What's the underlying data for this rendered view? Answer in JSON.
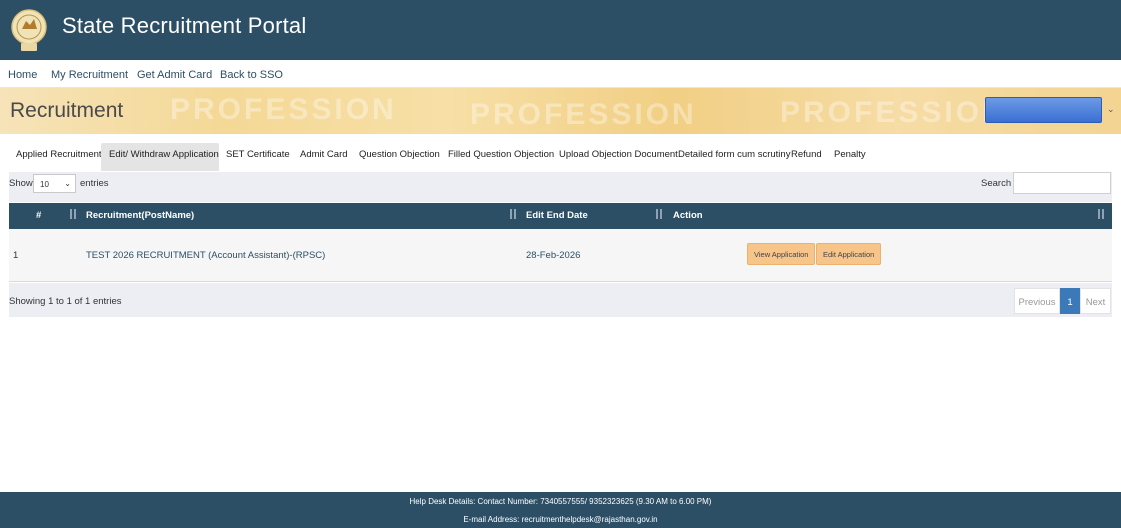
{
  "header": {
    "title": "State Recruitment Portal",
    "logo_icon": "emblem-logo-icon"
  },
  "nav": {
    "items": [
      "Home",
      "My Recruitment",
      "Get Admit Card",
      "Back to SSO"
    ]
  },
  "banner": {
    "title": "Recruitment",
    "background_words": [
      "PROFESSION",
      "PROFESSION",
      "PROFESSION"
    ]
  },
  "tabs": {
    "items": [
      "Applied Recruitment",
      "Edit/ Withdraw Application",
      "SET Certificate",
      "Admit Card",
      "Question Objection",
      "Filled Question Objection",
      "Upload Objection Document",
      "Detailed form cum scrutiny",
      "Refund",
      "Penalty"
    ],
    "active_index": 1
  },
  "controls": {
    "show_label": "Show",
    "entries_value": "10",
    "entries_label": "entries",
    "search_label": "Search",
    "search_value": ""
  },
  "table": {
    "headers": [
      "#",
      "Recruitment(PostName)",
      "Edit End Date",
      "Action"
    ],
    "rows": [
      {
        "index": "1",
        "post": "TEST 2026 RECRUITMENT (Account Assistant)-(RPSC)",
        "end_date": "28-Feb-2026",
        "actions": [
          "View Application",
          "Edit Application"
        ]
      }
    ]
  },
  "pagination": {
    "info": "Showing 1 to 1 of 1 entries",
    "previous": "Previous",
    "current": "1",
    "next": "Next"
  },
  "footer": {
    "helpdesk": "Help Desk Details: Contact Number: 7340557555/ 9352323625 (9.30 AM to 6.00 PM)",
    "email": "E-mail Address: recruitmenthelpdesk@rajasthan.gov.in"
  },
  "colors": {
    "primary": "#2c4f66",
    "button": "#f7c48a",
    "pager_active": "#3b79b8"
  }
}
